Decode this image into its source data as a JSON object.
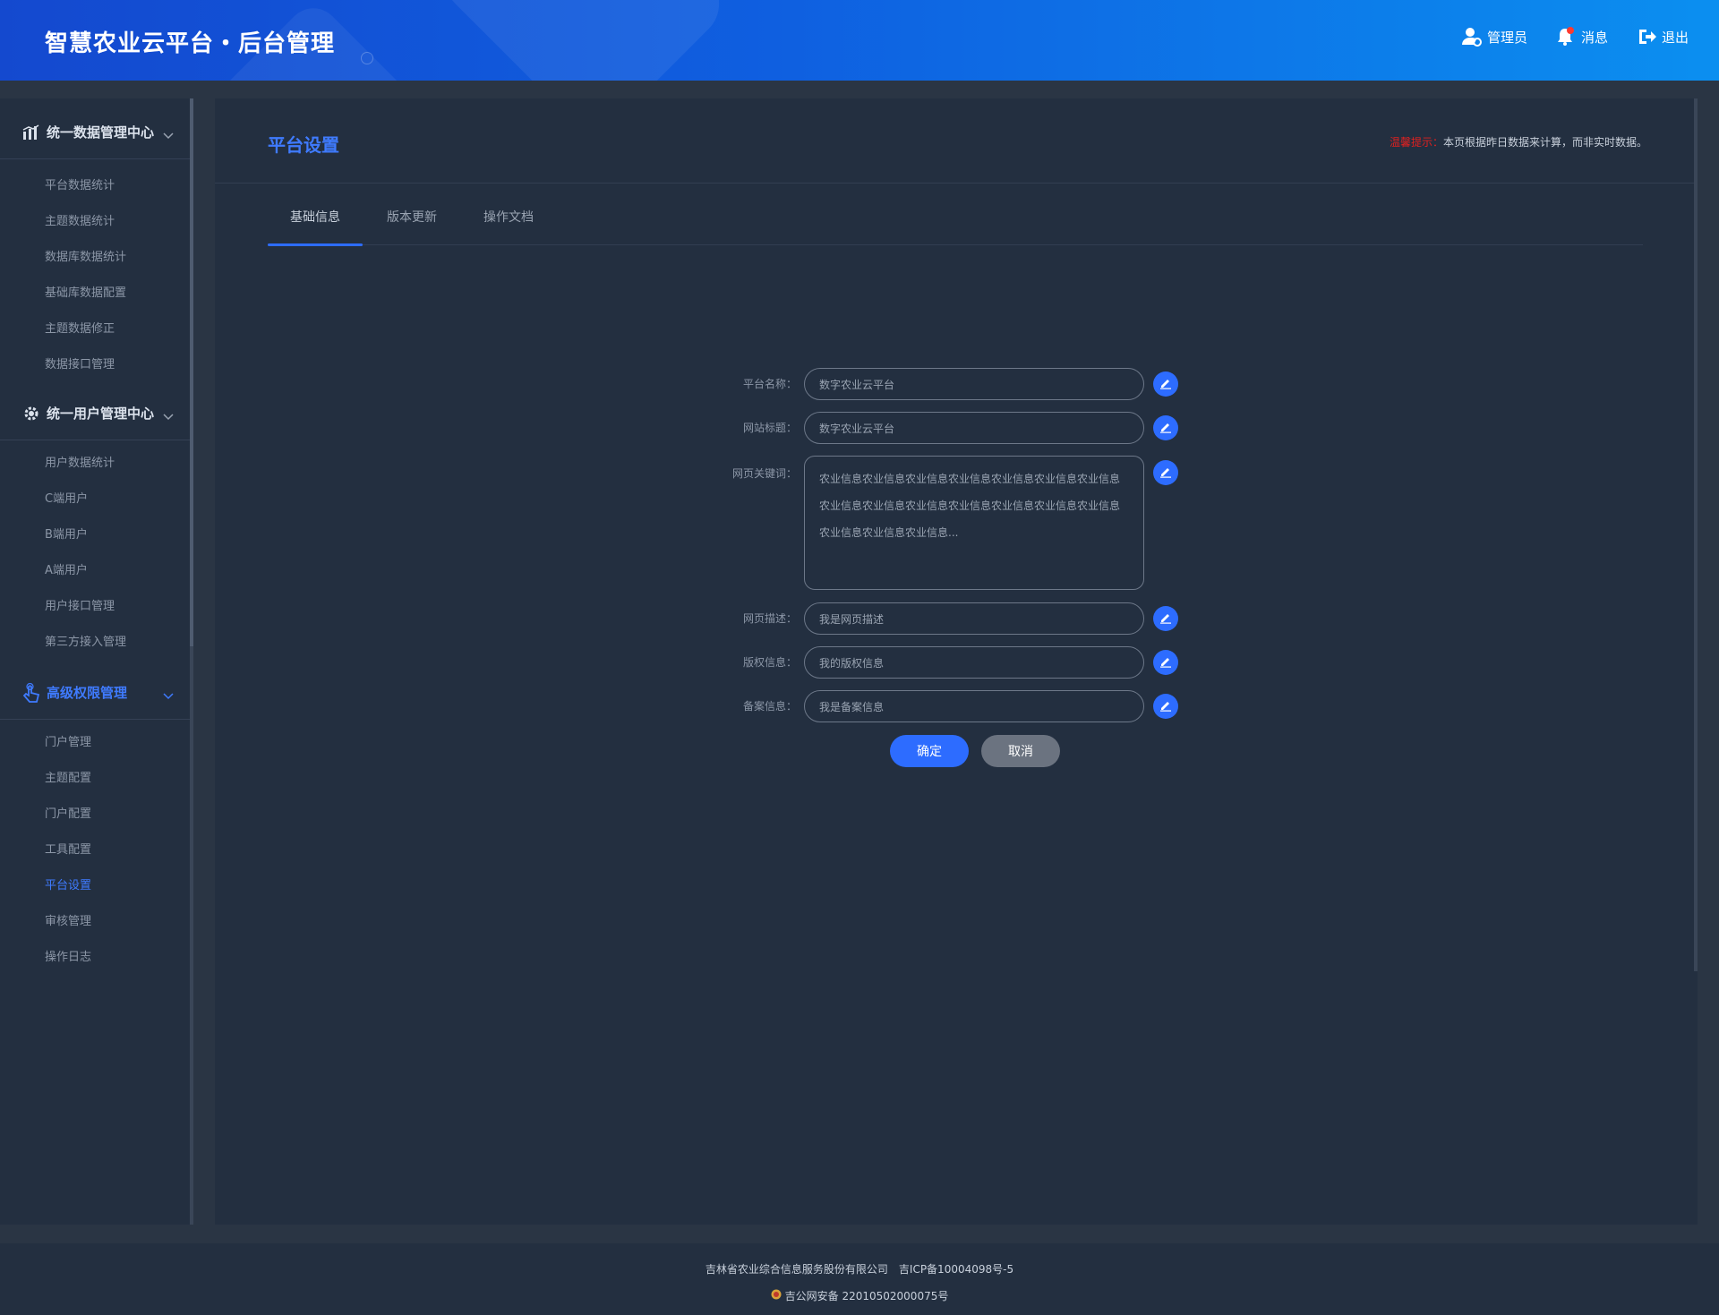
{
  "header": {
    "title": "智慧农业云平台・后台管理",
    "actions": [
      {
        "label": "管理员",
        "icon": "user-gear-icon"
      },
      {
        "label": "消息",
        "icon": "bell-icon"
      },
      {
        "label": "退出",
        "icon": "logout-icon"
      }
    ]
  },
  "sidebar": {
    "sections": [
      {
        "label": "统一数据管理中心",
        "icon": "chart-icon",
        "items": [
          "平台数据统计",
          "主题数据统计",
          "数据库数据统计",
          "基础库数据配置",
          "主题数据修正",
          "数据接口管理"
        ]
      },
      {
        "label": "统一用户管理中心",
        "icon": "gear-icon",
        "items": [
          "用户数据统计",
          "C端用户",
          "B端用户",
          "A端用户",
          "用户接口管理",
          "第三方接入管理"
        ]
      },
      {
        "label": "高级权限管理",
        "icon": "touch-icon",
        "active": true,
        "items": [
          "门户管理",
          "主题配置",
          "门户配置",
          "工具配置",
          "平台设置",
          "审核管理",
          "操作日志"
        ],
        "active_item": "平台设置"
      }
    ]
  },
  "main": {
    "title": "平台设置",
    "tip_key": "温馨提示：",
    "tip_text": "本页根据昨日数据来计算，而非实时数据。",
    "tabs": [
      "基础信息",
      "版本更新",
      "操作文档"
    ],
    "active_tab": "基础信息",
    "form": {
      "platform_name": {
        "label": "平台名称：",
        "value": "数字农业云平台"
      },
      "site_title": {
        "label": "网站标题：",
        "value": "数字农业云平台"
      },
      "keywords": {
        "label": "网页关键词：",
        "value": "农业信息农业信息农业信息农业信息农业信息农业信息农业信息农业信息农业信息农业信息农业信息农业信息农业信息农业信息农业信息农业信息农业信息..."
      },
      "description": {
        "label": "网页描述：",
        "value": "我是网页描述"
      },
      "copyright": {
        "label": "版权信息：",
        "value": "我的版权信息"
      },
      "record": {
        "label": "备案信息：",
        "value": "我是备案信息"
      },
      "confirm_label": "确定",
      "cancel_label": "取消"
    }
  },
  "footer": {
    "company": "吉林省农业综合信息服务股份有限公司",
    "icp": "吉ICP备10004098号-5",
    "police": "吉公网安备 22010502000075号"
  },
  "colors": {
    "accent": "#2d6cff",
    "header_start": "#1449cf",
    "header_end": "#0b8ff0",
    "panel": "#232f40",
    "background": "#2a3544",
    "tip_red": "#e0201f"
  }
}
